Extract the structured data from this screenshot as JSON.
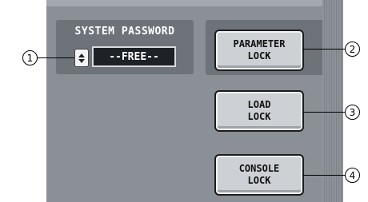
{
  "system_password": {
    "title": "SYSTEM PASSWORD",
    "value": "--FREE--",
    "spinner_icon": "up-down-arrows-icon"
  },
  "buttons": {
    "parameter_lock": "PARAMETER\nLOCK",
    "load_lock": "LOAD\nLOCK",
    "console_lock": "CONSOLE\nLOCK"
  },
  "callouts": [
    "1",
    "2",
    "3",
    "4"
  ],
  "colors": {
    "panel": "#8b9097",
    "group_box": "#6e737a",
    "button_face": "#cdd0d4",
    "display_bg": "#1e2125"
  }
}
